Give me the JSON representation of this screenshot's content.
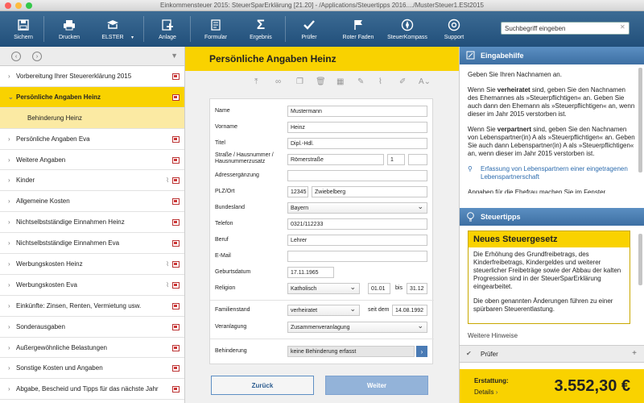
{
  "window": {
    "title": "Einkommensteuer 2015: SteuerSparErklärung [21.20] - /Applications/Steuertipps 2016..../MusterSteuer1.ESt2015"
  },
  "toolbar": {
    "buttons": [
      {
        "label": "Sichern",
        "icon": "save-icon"
      },
      {
        "label": "Drucken",
        "icon": "print-icon"
      },
      {
        "label": "ELSTER",
        "icon": "elster-icon"
      },
      {
        "label": "Anlage",
        "icon": "add-icon"
      },
      {
        "label": "Formular",
        "icon": "form-icon"
      },
      {
        "label": "Ergebnis",
        "icon": "sum-icon"
      },
      {
        "label": "Prüfer",
        "icon": "check-icon"
      },
      {
        "label": "Roter Faden",
        "icon": "flag-icon"
      },
      {
        "label": "SteuerKompass",
        "icon": "compass-icon"
      },
      {
        "label": "Support",
        "icon": "support-icon"
      }
    ],
    "search": {
      "value": "Suchbegriff eingeben"
    }
  },
  "sidebar": {
    "items": [
      {
        "label": "Vorbereitung Ihrer Steuererklärung 2015",
        "attachment": false
      },
      {
        "label": "Persönliche Angaben Heinz",
        "active": true,
        "attachment": false
      },
      {
        "label": "Behinderung Heinz",
        "sub": true
      },
      {
        "label": "Persönliche Angaben Eva",
        "attachment": false
      },
      {
        "label": "Weitere Angaben",
        "attachment": false
      },
      {
        "label": "Kinder",
        "attachment": true
      },
      {
        "label": "Allgemeine Kosten",
        "attachment": false
      },
      {
        "label": "Nichtselbstständige Einnahmen Heinz",
        "attachment": false
      },
      {
        "label": "Nichtselbstständige Einnahmen Eva",
        "attachment": false
      },
      {
        "label": "Werbungskosten Heinz",
        "attachment": true
      },
      {
        "label": "Werbungskosten Eva",
        "attachment": true
      },
      {
        "label": "Einkünfte: Zinsen, Renten, Vermietung usw.",
        "attachment": false
      },
      {
        "label": "Sonderausgaben",
        "attachment": false
      },
      {
        "label": "Außergewöhnliche Belastungen",
        "attachment": false
      },
      {
        "label": "Sonstige Kosten und Angaben",
        "attachment": false
      },
      {
        "label": "Abgabe, Bescheid und Tipps für das nächste Jahr",
        "attachment": false
      }
    ]
  },
  "main": {
    "title": "Persönliche Angaben Heinz",
    "form": {
      "name": {
        "label": "Name",
        "value": "Mustermann"
      },
      "vorname": {
        "label": "Vorname",
        "value": "Heinz"
      },
      "titel": {
        "label": "Titel",
        "value": "Dipl.-Hdl."
      },
      "strasse": {
        "label": "Straße / Hausnummer / Hausnummerzusatz",
        "value": "Römerstraße",
        "nr": "1",
        "zusatz": ""
      },
      "adresserg": {
        "label": "Adressergänzung",
        "value": ""
      },
      "plzort": {
        "label": "PLZ/Ort",
        "plz": "12345",
        "ort": "Zwiebelberg"
      },
      "bundesland": {
        "label": "Bundesland",
        "value": "Bayern"
      },
      "telefon": {
        "label": "Telefon",
        "value": "0321/112233"
      },
      "beruf": {
        "label": "Beruf",
        "value": "Lehrer"
      },
      "email": {
        "label": "E-Mail",
        "value": ""
      },
      "geburtsdatum": {
        "label": "Geburtsdatum",
        "value": "17.11.1965"
      },
      "religion": {
        "label": "Religion",
        "value": "Katholisch",
        "von": "01.01",
        "bis_label": "bis",
        "bis": "31.12"
      },
      "familienstand": {
        "label": "Familienstand",
        "value": "verheiratet",
        "seit_label": "seit dem",
        "seit": "14.08.1992"
      },
      "veranlagung": {
        "label": "Veranlagung",
        "value": "Zusammenveranlagung"
      },
      "behinderung": {
        "label": "Behinderung",
        "value": "keine Behinderung erfasst"
      }
    },
    "back_label": "Zurück",
    "next_label": "Weiter"
  },
  "right": {
    "help_title": "Eingabehilfe",
    "help_p1": "Geben Sie Ihren Nachnamen an.",
    "help_p2a": "Wenn Sie ",
    "help_p2b": "verheiratet",
    "help_p2c": " sind, geben Sie den Nachnamen des Ehemannes als »Steuerpflichtigen« an. Geben Sie auch dann den Ehemann als »Steuerpflichtigen« an, wenn dieser im Jahr 2015 verstorben ist.",
    "help_p3a": "Wenn Sie ",
    "help_p3b": "verpartnert",
    "help_p3c": " sind, geben Sie den Nachnamen von Lebenspartner(in) A als »Steuerpflichtigen« an. Geben Sie auch dann Lebenspartner(in) A als »Steuerpflichtigen« an, wenn dieser im Jahr 2015 verstorben ist.",
    "help_link": "Erfassung von Lebenspartnern einer eingetragenen Lebenspartnerschaft",
    "help_cut": "Angaben für die Ehefrau machen Sie im Fenster",
    "tips_title": "Steuertipps",
    "tip_head": "Neues Steuergesetz",
    "tip_p1": "Die Erhöhung des Grundfreibetrags, des Kinderfreibetrags, Kindergeldes und weiterer steuerlicher Freibeträge sowie der Abbau der kalten Progression sind in der SteuerSparErklärung eingearbeitet.",
    "tip_p2": "Die oben genannten Änderungen führen zu einer spürbaren Steuerentlastung.",
    "tip_more": "Weitere Hinweise",
    "pruefer_title": "Prüfer",
    "pruefer_plus": "+",
    "refund_label": "Erstattung:",
    "details_label": "Details",
    "refund_value": "3.552,30 €"
  }
}
